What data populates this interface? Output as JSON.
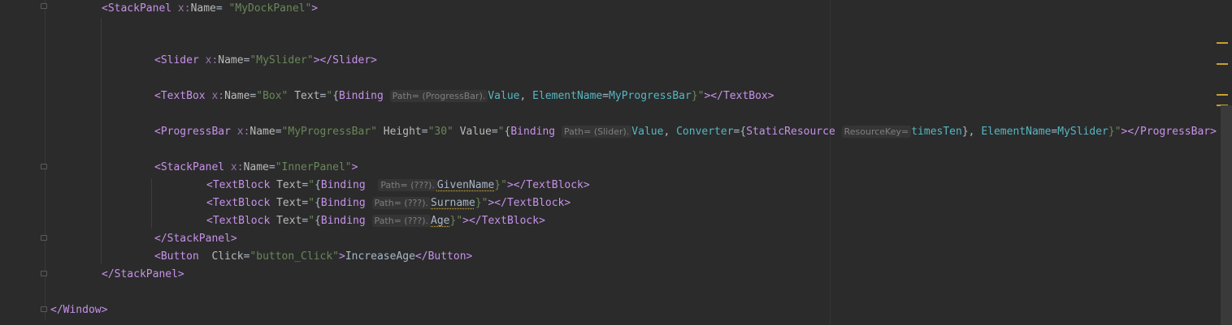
{
  "lines": {
    "l1": {
      "open": "<StackPanel",
      "ns": "x:",
      "attr": "Name",
      "eq": "= ",
      "val": "\"MyDockPanel\"",
      "close": ">"
    },
    "l2": {
      "open": "<Slider",
      "ns": "x:",
      "attr": "Name",
      "eq": "=",
      "val": "\"MySlider\"",
      "close": "></Slider>"
    },
    "l3": {
      "open": "<TextBox",
      "ns": "x:",
      "attr": "Name",
      "eq": "=",
      "val": "\"Box\"",
      "attr2": "Text",
      "eq2": "=",
      "q": "\"",
      "brace": "{",
      "kw": "Binding",
      "hint": "Path= (ProgressBar).",
      "prop": "Value",
      "comma": ", ",
      "attr3": "ElementName",
      "eq3": "=",
      "elem": "MyProgressBar",
      "end": "}\"",
      "close": "></TextBox>"
    },
    "l4": {
      "open": "<ProgressBar",
      "ns": "x:",
      "attr": "Name",
      "eq": "=",
      "val": "\"MyProgressBar\"",
      "attr2": "Height",
      "eq2": "=",
      "val2": "\"30\"",
      "attr3": "Value",
      "eq3": "=",
      "q": "\"",
      "brace": "{",
      "kw": "Binding",
      "hint": "Path= (Slider).",
      "prop": "Value",
      "comma": ", ",
      "attr4": "Converter",
      "eq4": "=",
      "brace2": "{",
      "kw2": "StaticResource",
      "hint2": "ResourceKey=",
      "res": "timesTen",
      "endbrace": "}",
      "comma2": ", ",
      "attr5": "ElementName",
      "eq5": "=",
      "elem": "MySlider",
      "end": "}\"",
      "close": "></ProgressBar>"
    },
    "l5": {
      "open": "<StackPanel",
      "ns": "x:",
      "attr": "Name",
      "eq": "=",
      "val": "\"InnerPanel\"",
      "close": ">"
    },
    "l6": {
      "open": "<TextBlock",
      "attr": "Text",
      "eq": "=",
      "q": "\"",
      "brace": "{",
      "kw": "Binding",
      "hint": "Path= (???).",
      "prop": "GivenName",
      "end": "}\"",
      "close": "></TextBlock>"
    },
    "l7": {
      "open": "<TextBlock",
      "attr": "Text",
      "eq": "=",
      "q": "\"",
      "brace": "{",
      "kw": "Binding",
      "hint": "Path= (???).",
      "prop": "Surname",
      "end": "}\"",
      "close": "></TextBlock>"
    },
    "l8": {
      "open": "<TextBlock",
      "attr": "Text",
      "eq": "=",
      "q": "\"",
      "brace": "{",
      "kw": "Binding",
      "hint": "Path= (???).",
      "prop": "Age",
      "end": "}\"",
      "close": "></TextBlock>"
    },
    "l9": {
      "close": "</StackPanel>"
    },
    "l10": {
      "open": "<Button",
      "attr": "Click",
      "eq": "=",
      "val": "\"button_Click\"",
      "gt": ">",
      "text": "IncreaseAge",
      "close": "</Button>"
    },
    "l11": {
      "close": "</StackPanel>"
    },
    "l12": {
      "close": "</Window>"
    }
  },
  "colors": {
    "background": "#2b2b2b",
    "tag": "#c792ea",
    "string": "#6a8759",
    "property": "#56b6c2",
    "warning": "#c8a032"
  }
}
